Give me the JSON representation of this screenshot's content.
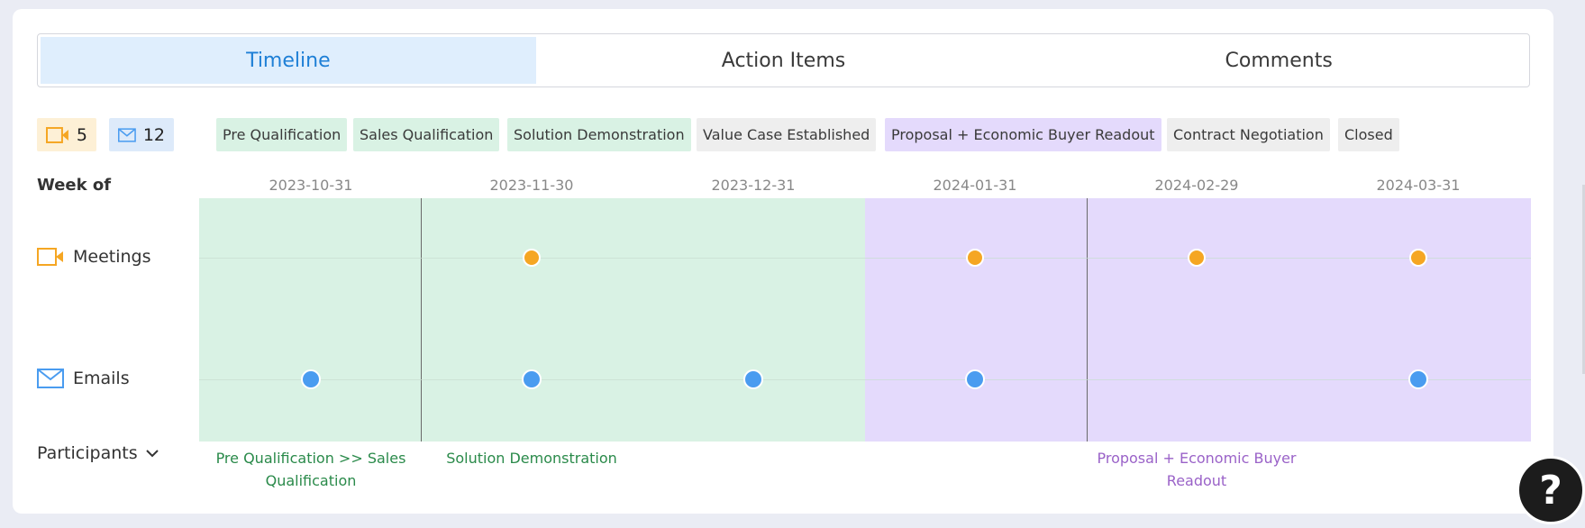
{
  "tabs": [
    {
      "label": "Timeline",
      "active": true
    },
    {
      "label": "Action Items",
      "active": false
    },
    {
      "label": "Comments",
      "active": false
    }
  ],
  "counts": {
    "meetings": "5",
    "emails": "12"
  },
  "stages": [
    {
      "label": "Pre Qualification",
      "status": "completed"
    },
    {
      "label": "Sales Qualification",
      "status": "completed"
    },
    {
      "label": "Solution Demonstration",
      "status": "completed"
    },
    {
      "label": "Value Case Established",
      "status": "skipped"
    },
    {
      "label": "Proposal + Economic Buyer Readout",
      "status": "current"
    },
    {
      "label": "Contract Negotiation",
      "status": "upcoming"
    },
    {
      "label": "Closed",
      "status": "upcoming"
    }
  ],
  "timeline": {
    "week_of_label": "Week of",
    "dates": [
      "2023-10-31",
      "2023-11-30",
      "2023-12-31",
      "2024-01-31",
      "2024-02-29",
      "2024-03-31"
    ],
    "rows": {
      "meetings": "Meetings",
      "emails": "Emails"
    },
    "meetings_at": [
      1,
      3,
      4,
      5
    ],
    "emails_at": [
      0,
      1,
      2,
      3,
      5
    ],
    "transitions": [
      {
        "label": "Pre Qualification >> Sales Qualification",
        "at_date_index": 0,
        "color": "#2a8a4a"
      },
      {
        "label": "Solution Demonstration",
        "at_date_index": 1,
        "color": "#2a8a4a"
      },
      {
        "label": "Proposal + Economic Buyer Readout",
        "at_date_index": 4,
        "color": "#9a62c8"
      }
    ]
  },
  "participants_label": "Participants",
  "help_label": "?",
  "colors": {
    "active_tab": "#1e7fd6",
    "meeting": "#f5a623",
    "email": "#4a9cf0",
    "green_stage": "#d9f2e4",
    "purple_stage": "#e4dafc"
  }
}
